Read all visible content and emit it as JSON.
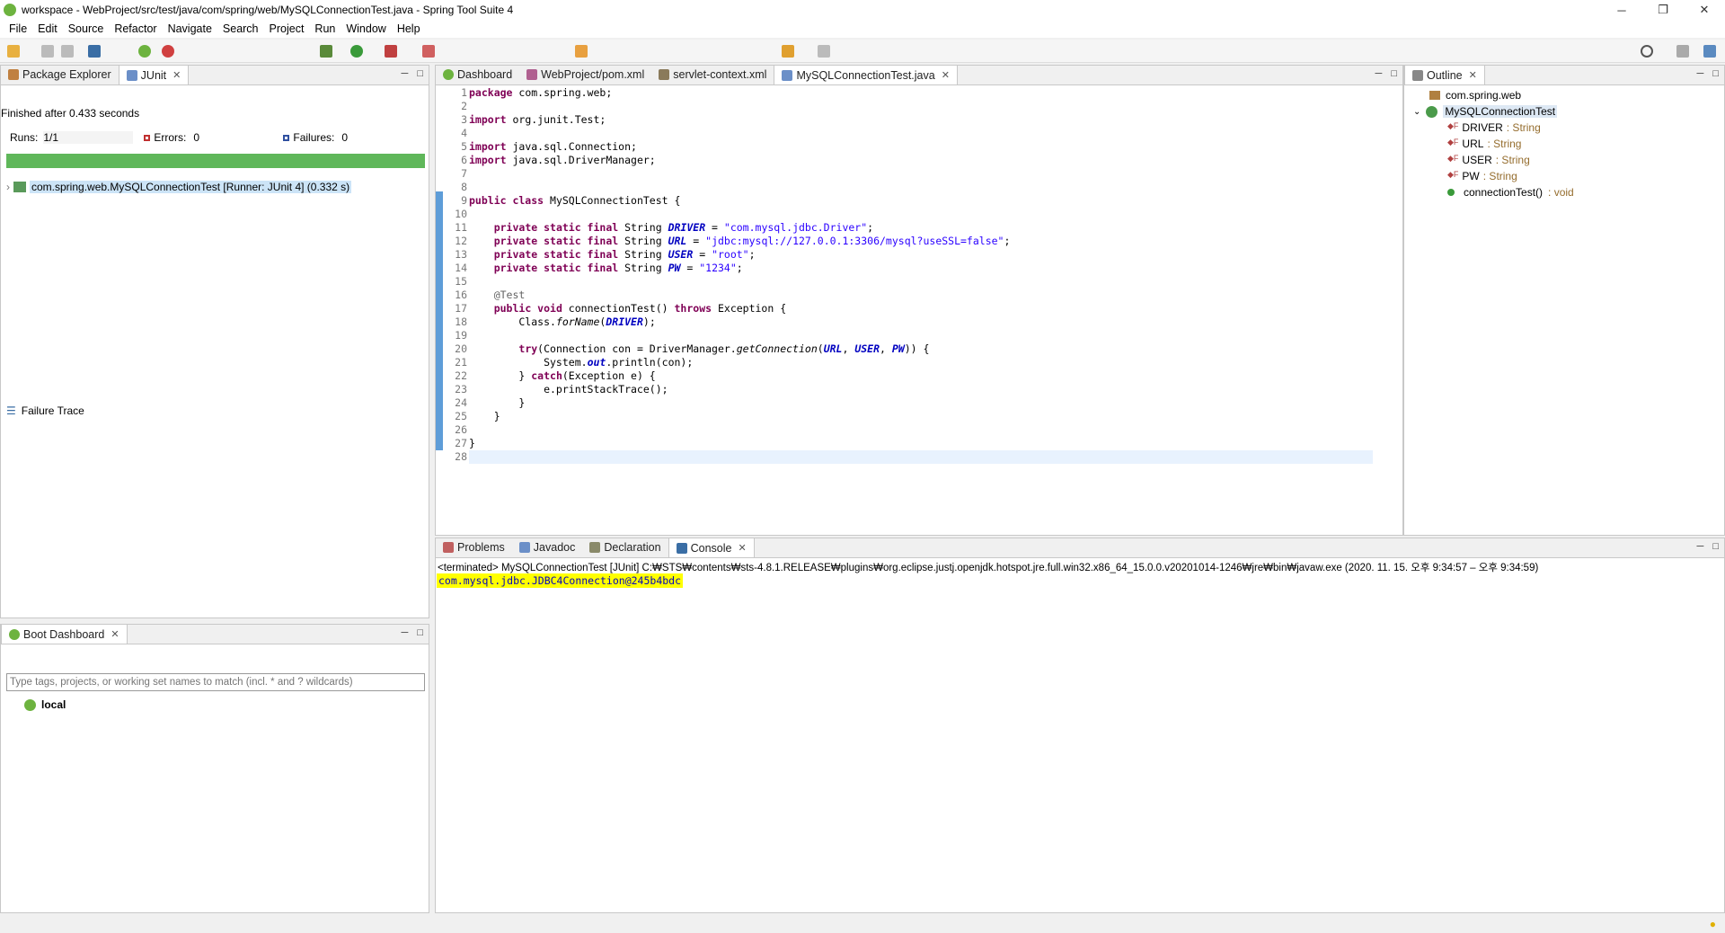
{
  "window": {
    "title": "workspace - WebProject/src/test/java/com/spring/web/MySQLConnectionTest.java - Spring Tool Suite 4"
  },
  "menu": [
    "File",
    "Edit",
    "Source",
    "Refactor",
    "Navigate",
    "Search",
    "Project",
    "Run",
    "Window",
    "Help"
  ],
  "left_top": {
    "tabs": [
      {
        "label": "Package Explorer"
      },
      {
        "label": "JUnit"
      }
    ],
    "finished": "Finished after 0.433 seconds",
    "runs_label": "Runs:",
    "runs": "1/1",
    "errors_label": "Errors:",
    "errors": "0",
    "failures_label": "Failures:",
    "failures": "0",
    "progress": 1.0,
    "test_item": "com.spring.web.MySQLConnectionTest [Runner: JUnit 4] (0.332 s)",
    "failure_trace": "Failure Trace"
  },
  "boot": {
    "tab": "Boot Dashboard",
    "filter_placeholder": "Type tags, projects, or working set names to match (incl. * and ? wildcards)",
    "local": "local"
  },
  "editor": {
    "tabs": [
      {
        "label": "Dashboard"
      },
      {
        "label": "WebProject/pom.xml"
      },
      {
        "label": "servlet-context.xml"
      },
      {
        "label": "MySQLConnectionTest.java",
        "active": true
      }
    ],
    "line_numbers": [
      "1",
      "2",
      "3",
      "4",
      "5",
      "6",
      "7",
      "8",
      "9",
      "10",
      "11",
      "12",
      "13",
      "14",
      "15",
      "16",
      "17",
      "18",
      "19",
      "20",
      "21",
      "22",
      "23",
      "24",
      "25",
      "26",
      "27",
      "28"
    ]
  },
  "outline": {
    "tab": "Outline",
    "package": "com.spring.web",
    "class": "MySQLConnectionTest",
    "members": [
      {
        "name": "DRIVER",
        "type": ": String"
      },
      {
        "name": "URL",
        "type": ": String"
      },
      {
        "name": "USER",
        "type": ": String"
      },
      {
        "name": "PW",
        "type": ": String"
      },
      {
        "name": "connectionTest()",
        "type": ": void"
      }
    ]
  },
  "bottom": {
    "tabs": [
      {
        "label": "Problems"
      },
      {
        "label": "Javadoc"
      },
      {
        "label": "Declaration"
      },
      {
        "label": "Console",
        "active": true
      }
    ],
    "terminated": "<terminated> MySQLConnectionTest [JUnit] C:₩STS₩contents₩sts-4.8.1.RELEASE₩plugins₩org.eclipse.justj.openjdk.hotspot.jre.full.win32.x86_64_15.0.0.v20201014-1246₩jre₩bin₩javaw.exe  (2020. 11. 15. 오후 9:34:57 – 오후 9:34:59)",
    "output": "com.mysql.jdbc.JDBC4Connection@245b4bdc"
  },
  "colors": {
    "progress_green": "#5fb75a",
    "keyword": "#7f0055",
    "string": "#2a00ff",
    "field": "#0000c0",
    "console_highlight": "#ffff00"
  }
}
